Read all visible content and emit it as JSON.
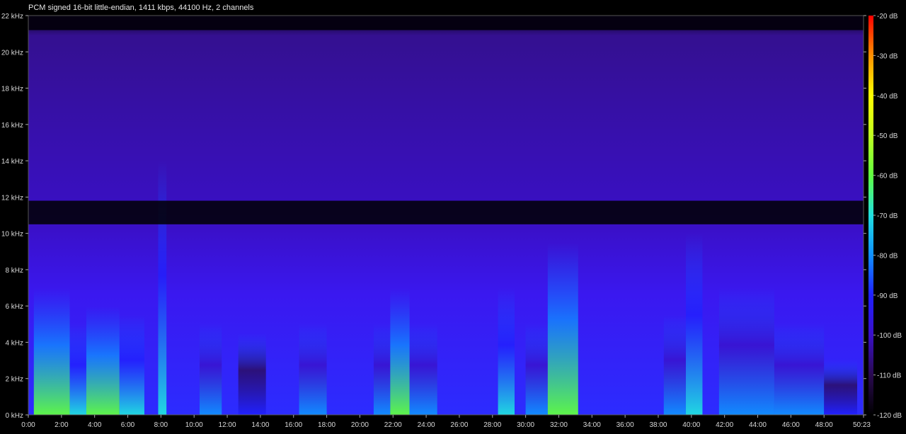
{
  "title": "PCM signed 16-bit little-endian, 1411 kbps, 44100 Hz, 2 channels",
  "chart_data": {
    "type": "heatmap",
    "title": "PCM signed 16-bit little-endian, 1411 kbps, 44100 Hz, 2 channels",
    "xlabel": "",
    "ylabel": "",
    "x_ticks": [
      "0:00",
      "2:00",
      "4:00",
      "6:00",
      "8:00",
      "10:00",
      "12:00",
      "14:00",
      "16:00",
      "18:00",
      "20:00",
      "22:00",
      "24:00",
      "26:00",
      "28:00",
      "30:00",
      "32:00",
      "34:00",
      "36:00",
      "38:00",
      "40:00",
      "42:00",
      "44:00",
      "46:00",
      "48:00",
      "50:23"
    ],
    "x_tick_seconds": [
      0,
      120,
      240,
      360,
      480,
      600,
      720,
      840,
      960,
      1080,
      1200,
      1320,
      1440,
      1560,
      1680,
      1800,
      1920,
      2040,
      2160,
      2280,
      2400,
      2520,
      2640,
      2760,
      2880,
      3023
    ],
    "xlim_seconds": [
      0,
      3023
    ],
    "y_ticks": [
      "0 kHz",
      "2 kHz",
      "4 kHz",
      "6 kHz",
      "8 kHz",
      "10 kHz",
      "12 kHz",
      "14 kHz",
      "16 kHz",
      "18 kHz",
      "20 kHz",
      "22 kHz"
    ],
    "ylim_khz": [
      0,
      22
    ],
    "colorbar_ticks": [
      "-20 dB",
      "-30 dB",
      "-40 dB",
      "-50 dB",
      "-60 dB",
      "-70 dB",
      "-80 dB",
      "-90 dB",
      "-100 dB",
      "-110 dB",
      "-120 dB"
    ],
    "colorbar_range_db": [
      -120,
      -20
    ],
    "colorscale": [
      "#000000",
      "#2a0a50",
      "#3a10c8",
      "#2020ff",
      "#1090ff",
      "#20e0e0",
      "#60ff40",
      "#c0ff20",
      "#ffff00",
      "#ff9000",
      "#ff0000"
    ],
    "notch_band_khz": [
      10.5,
      11.8
    ],
    "activity": [
      {
        "x": [
          20,
          150
        ],
        "peak_khz": 7.0,
        "level_db": -60
      },
      {
        "x": [
          150,
          210
        ],
        "peak_khz": 5.0,
        "level_db": -70
      },
      {
        "x": [
          210,
          330
        ],
        "peak_khz": 6.0,
        "level_db": -65
      },
      {
        "x": [
          330,
          420
        ],
        "peak_khz": 5.5,
        "level_db": -72
      },
      {
        "x": [
          470,
          500
        ],
        "peak_khz": 14.0,
        "level_db": -70
      },
      {
        "x": [
          620,
          700
        ],
        "peak_khz": 5.0,
        "level_db": -85
      },
      {
        "x": [
          760,
          860
        ],
        "peak_khz": 4.5,
        "level_db": -88
      },
      {
        "x": [
          980,
          1080
        ],
        "peak_khz": 5.0,
        "level_db": -85
      },
      {
        "x": [
          1250,
          1310
        ],
        "peak_khz": 5.0,
        "level_db": -80
      },
      {
        "x": [
          1310,
          1380
        ],
        "peak_khz": 7.0,
        "level_db": -65
      },
      {
        "x": [
          1380,
          1480
        ],
        "peak_khz": 5.0,
        "level_db": -84
      },
      {
        "x": [
          1700,
          1760
        ],
        "peak_khz": 7.0,
        "level_db": -70
      },
      {
        "x": [
          1800,
          1880
        ],
        "peak_khz": 5.0,
        "level_db": -80
      },
      {
        "x": [
          1880,
          1990
        ],
        "peak_khz": 9.5,
        "level_db": -65
      },
      {
        "x": [
          2300,
          2380
        ],
        "peak_khz": 5.5,
        "level_db": -80
      },
      {
        "x": [
          2380,
          2440
        ],
        "peak_khz": 10.0,
        "level_db": -70
      },
      {
        "x": [
          2500,
          2700
        ],
        "peak_khz": 7.0,
        "level_db": -83
      },
      {
        "x": [
          2700,
          2880
        ],
        "peak_khz": 5.0,
        "level_db": -85
      },
      {
        "x": [
          2880,
          3000
        ],
        "peak_khz": 3.0,
        "level_db": -95
      }
    ]
  }
}
